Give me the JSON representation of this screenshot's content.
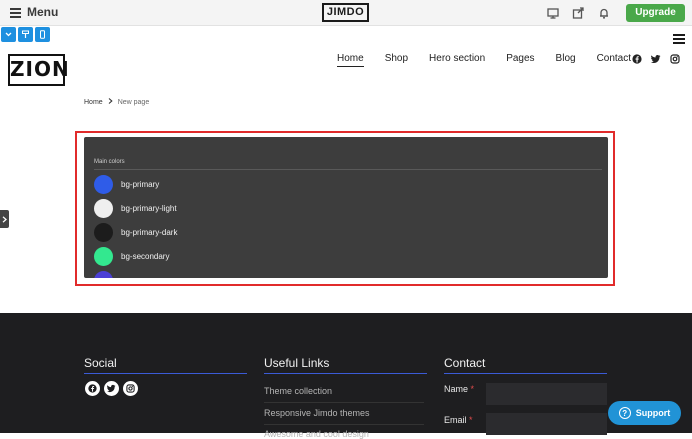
{
  "editor": {
    "menu_label": "Menu",
    "logo": "JIMDO",
    "upgrade_label": "Upgrade",
    "icons": [
      "desktop-icon",
      "share-icon",
      "bell-icon"
    ],
    "device_icons": [
      "chevron-down-icon",
      "paint-roller-icon",
      "mobile-icon"
    ],
    "accent_color": "#4aa84a",
    "device_color": "#1e90e0"
  },
  "site": {
    "logo": "ZION",
    "nav": [
      {
        "label": "Home",
        "active": true
      },
      {
        "label": "Shop",
        "active": false
      },
      {
        "label": "Hero section",
        "active": false
      },
      {
        "label": "Pages",
        "active": false
      },
      {
        "label": "Blog",
        "active": false
      },
      {
        "label": "Contact",
        "active": false
      }
    ],
    "social_icons": [
      "facebook-icon",
      "twitter-icon",
      "instagram-icon"
    ]
  },
  "breadcrumb": {
    "home": "Home",
    "current": "New page"
  },
  "colors_widget": {
    "title": "Main colors",
    "swatches": [
      {
        "label": "bg-primary",
        "color": "#2f5ce8"
      },
      {
        "label": "bg-primary-light",
        "color": "#efefef"
      },
      {
        "label": "bg-primary-dark",
        "color": "#1c1c1c"
      },
      {
        "label": "bg-secondary",
        "color": "#33e88f"
      },
      {
        "label": "",
        "color": "#4b3fd6"
      }
    ]
  },
  "footer": {
    "social_heading": "Social",
    "links_heading": "Useful Links",
    "contact_heading": "Contact",
    "links": [
      "Theme collection",
      "Responsive Jimdo themes",
      "Awesome and cool design"
    ],
    "name_label": "Name",
    "email_label": "Email",
    "required_mark": "*",
    "underline_color": "#3b5bd6"
  },
  "support": {
    "label": "Support"
  }
}
